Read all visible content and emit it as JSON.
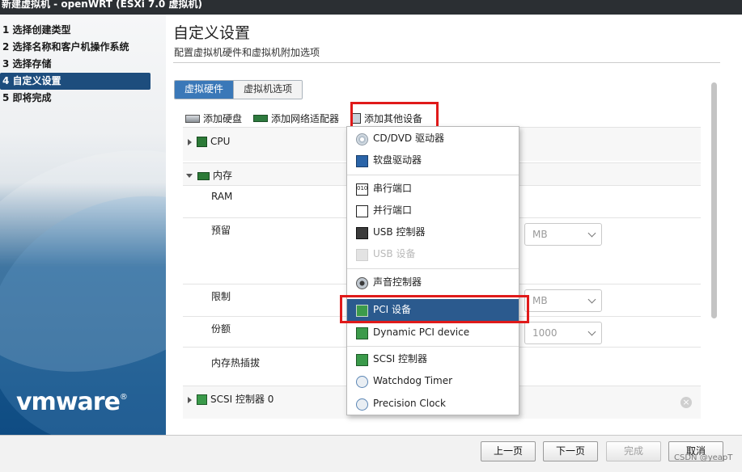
{
  "window_title": "新建虚拟机 - openWRT (ESXi 7.0 虚拟机)",
  "steps": [
    {
      "label": "1 选择创建类型"
    },
    {
      "label": "2 选择名称和客户机操作系统"
    },
    {
      "label": "3 选择存储"
    },
    {
      "label": "4 自定义设置"
    },
    {
      "label": "5 即将完成"
    }
  ],
  "logo": "vmware",
  "page": {
    "title": "自定义设置",
    "subtitle": "配置虚拟机硬件和虚拟机附加选项"
  },
  "tabs": [
    "虚拟硬件",
    "虚拟机选项"
  ],
  "toolbar": {
    "add_disk": "添加硬盘",
    "add_nic": "添加网络适配器",
    "add_other": "添加其他设备"
  },
  "settings": {
    "cpu": "CPU",
    "memory": "内存",
    "ram": "RAM",
    "reservation": "预留",
    "reservation_unit": "MB",
    "limit": "限制",
    "limit_unit": "MB",
    "shares": "份额",
    "shares_value": "1000",
    "hot_add": "内存热插拔",
    "scsi": "SCSI 控制器 0"
  },
  "menu": {
    "items": [
      {
        "label": "CD/DVD 驱动器",
        "icon": "cd-dvd-icon"
      },
      {
        "label": "软盘驱动器",
        "icon": "floppy-icon"
      },
      {
        "label": "串行端口",
        "icon": "serial-port-icon"
      },
      {
        "label": "并行端口",
        "icon": "parallel-port-icon"
      },
      {
        "label": "USB 控制器",
        "icon": "usb-controller-icon"
      },
      {
        "label": "USB 设备",
        "icon": "usb-device-icon"
      },
      {
        "label": "声音控制器",
        "icon": "sound-icon"
      },
      {
        "label": "PCI 设备",
        "icon": "pci-icon"
      },
      {
        "label": "Dynamic PCI device",
        "icon": "pci-icon"
      },
      {
        "label": "SCSI 控制器",
        "icon": "scsi-icon"
      },
      {
        "label": "Watchdog Timer",
        "icon": "watchdog-icon"
      },
      {
        "label": "Precision Clock",
        "icon": "clock-icon"
      }
    ]
  },
  "footer": {
    "prev": "上一页",
    "next": "下一页",
    "finish": "完成",
    "cancel": "取消"
  },
  "watermark": "CSDN @yeapT",
  "colors": {
    "accent": "#2b5a8e",
    "highlight_box": "#e01a1a",
    "tab_selected": "#3a78b8"
  }
}
